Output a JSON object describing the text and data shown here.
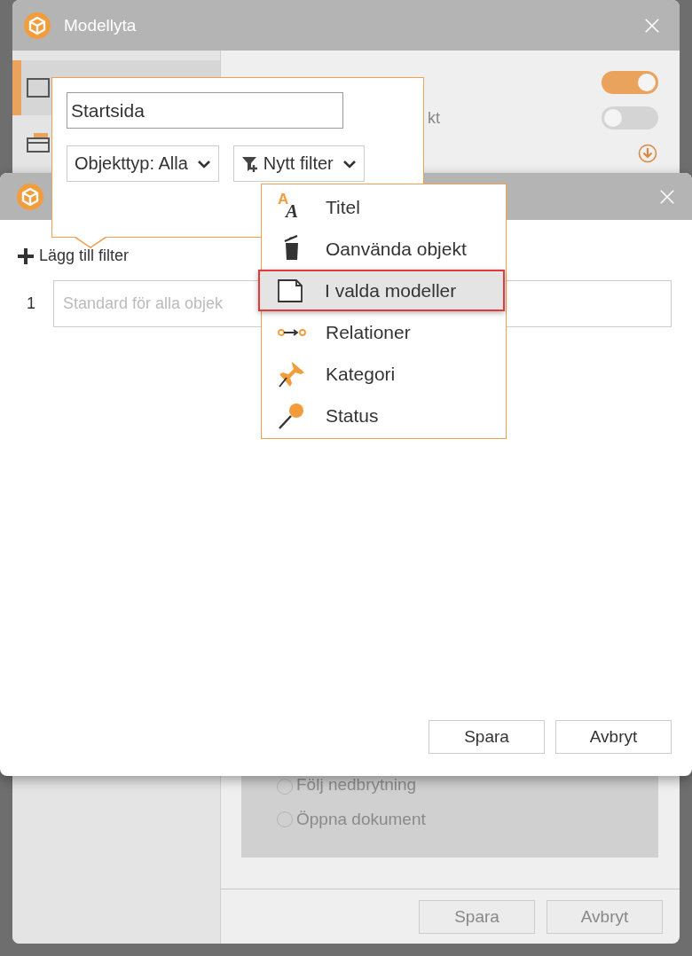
{
  "background_window": {
    "title": "Modellyta",
    "sidebar_items": [
      {
        "selected": true
      },
      {
        "selected": false
      }
    ],
    "toggles": [
      {
        "on": true
      },
      {
        "on": false
      }
    ],
    "label_fragment": "kt",
    "options": [
      {
        "label": "Följ nedbrytning",
        "selected": false
      },
      {
        "label": "Öppna dokument",
        "selected": false
      }
    ],
    "buttons": [
      "Spara",
      "Avbryt"
    ]
  },
  "dialog": {
    "add_filter": "Lägg till filter",
    "filters": [
      {
        "number": "1",
        "placeholder": "Standard för alla objek"
      }
    ],
    "buttons": [
      "Spara",
      "Avbryt"
    ]
  },
  "popover": {
    "name_field": {
      "value": "Startsida"
    },
    "object_type": "Objekttyp: Alla",
    "new_filter": "Nytt filter"
  },
  "menu": {
    "items": [
      {
        "kind": "title",
        "icon_letters": [
          "A",
          "A"
        ],
        "label": "Titel",
        "selected": false
      },
      {
        "kind": "unused",
        "label": "Oanvända objekt",
        "selected": false
      },
      {
        "kind": "models",
        "label": "I valda modeller",
        "selected": true
      },
      {
        "kind": "relations",
        "label": "Relationer",
        "selected": false
      },
      {
        "kind": "category",
        "label": "Kategori",
        "selected": false
      },
      {
        "kind": "status",
        "label": "Status",
        "selected": false
      }
    ]
  }
}
